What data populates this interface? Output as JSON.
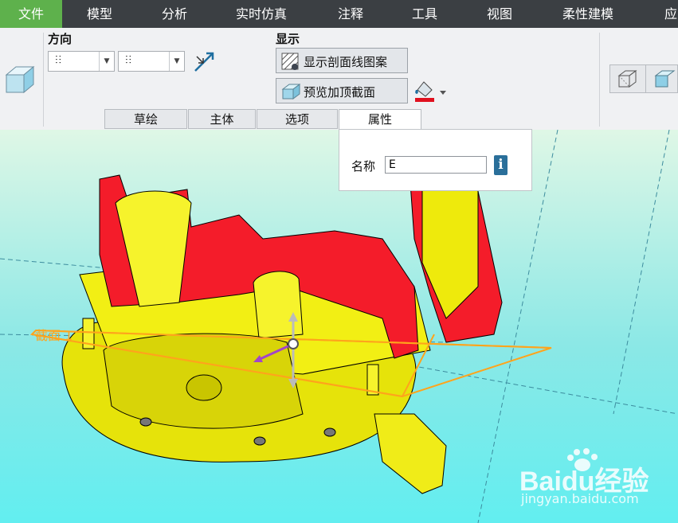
{
  "menu": {
    "items": [
      "文件",
      "模型",
      "分析",
      "实时仿真",
      "注释",
      "工具",
      "视图",
      "柔性建模",
      "应"
    ],
    "active": "文件"
  },
  "ribbon": {
    "direction_label": "方向",
    "display_label": "显示",
    "direction_select_1": "⫶⫶",
    "direction_select_2": "⫶⫶",
    "show_hatch_button": "显示剖面线图案",
    "preview_cap_button": "预览加顶截面"
  },
  "tabs": [
    "草绘",
    "主体",
    "选项",
    "属性"
  ],
  "active_tab": "属性",
  "properties": {
    "name_label": "名称",
    "name_value": "E",
    "info_icon": "i"
  },
  "viewport": {
    "section_label": "截面 1"
  },
  "watermark": {
    "brand": "Baidu经验",
    "url": "jingyan.baidu.com"
  },
  "colors": {
    "menubar": "#3b3f43",
    "menu_active": "#5eb14c",
    "part_yellow": "#ffff1a",
    "section_red": "#f41c2a",
    "plane_orange": "#ffa41c",
    "annotation_blue": "#1a2fd0"
  }
}
